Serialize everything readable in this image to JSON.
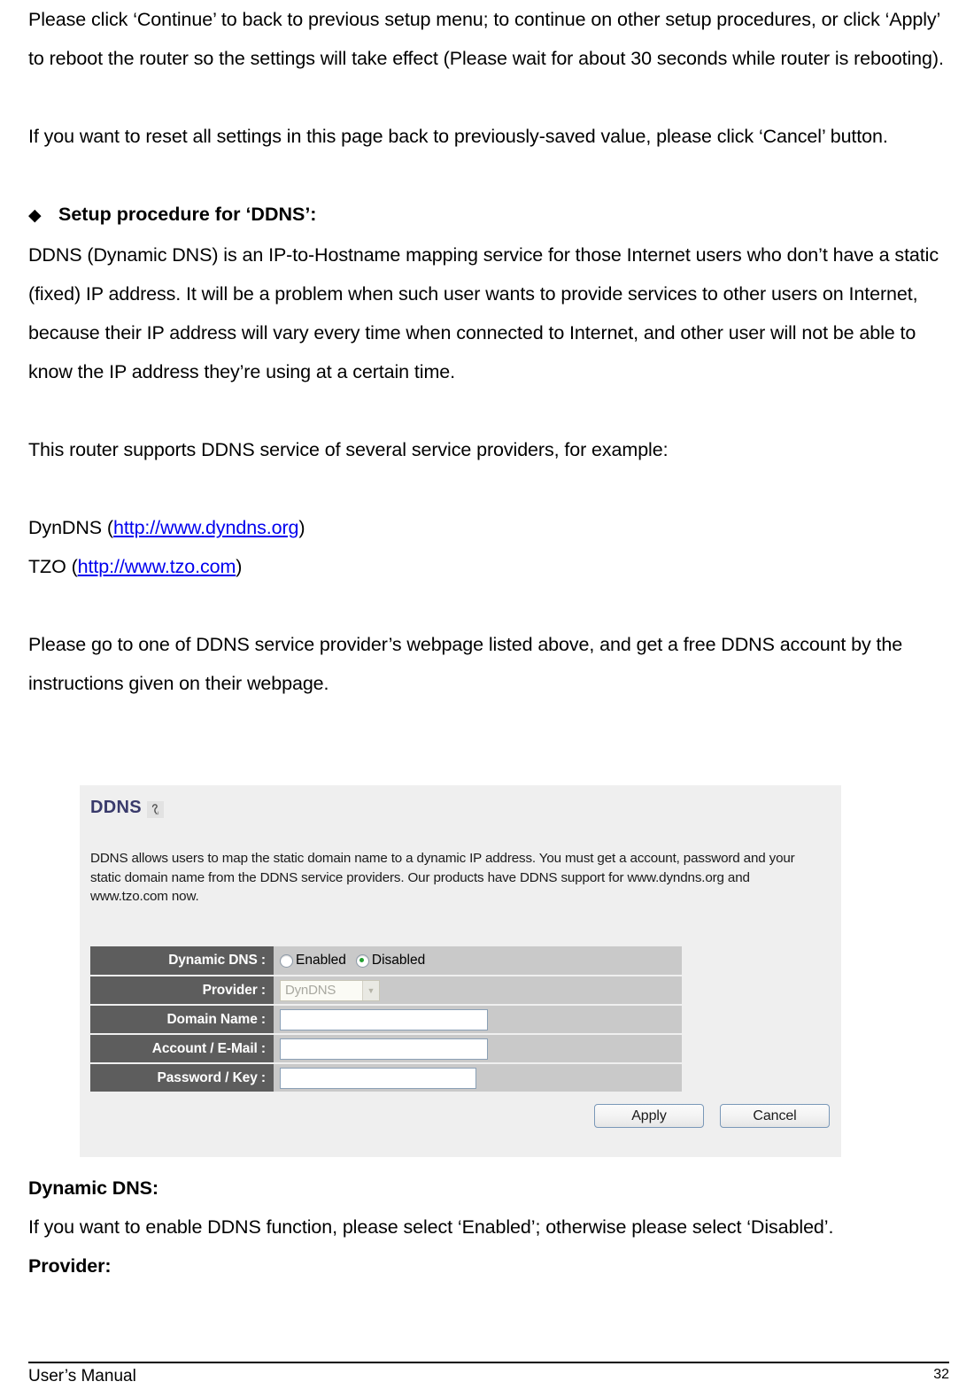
{
  "document": {
    "paragraphs": [
      "Please click ‘Continue’ to back to previous setup menu; to continue on other setup procedures, or click ‘Apply’ to reboot the router so the settings will take effect (Please wait for about 30 seconds while router is rebooting).",
      "If you want to reset all settings in this page back to previously-saved value, please click ‘Cancel’ button."
    ],
    "section_heading": {
      "bullet": "◆",
      "text": "Setup procedure for ‘DDNS’:"
    },
    "ddns_intro": "DDNS (Dynamic DNS) is an IP-to-Hostname mapping service for those Internet users who don’t have a static (fixed) IP address. It will be a problem when such user wants to provide services to other users on Internet, because their IP address will vary every time when connected to Internet, and other user will not be able to know the IP address they’re using at a certain time.",
    "providers_intro": "This router supports DDNS service of several service providers, for example:",
    "provider_links": [
      {
        "name": "DynDNS",
        "open": " (",
        "url": "http://www.dyndns.org",
        "close": ")"
      },
      {
        "name": "TZO",
        "open": " (",
        "url": "http://www.tzo.com",
        "close": ")"
      }
    ],
    "signup_text": "Please go to one of DDNS service provider’s webpage listed above, and get a free DDNS account by the instructions given on their webpage.",
    "after_panel": {
      "dynamic_dns_heading": "Dynamic DNS:",
      "dynamic_dns_body": "If you want to enable DDNS function, please select ‘Enabled’; otherwise please select ‘Disabled’.",
      "provider_heading": "Provider:"
    }
  },
  "panel": {
    "title": "DDNS",
    "title_icon": "help-question-icon",
    "description": "DDNS allows users to map the static domain name to a dynamic IP address. You must get a account, password and your static domain name from the DDNS service providers. Our products have DDNS support for www.dyndns.org and www.tzo.com now.",
    "title_color": "#393a6b",
    "label_bg": "#5d5d5d",
    "value_bg": "#c9c9c9",
    "panel_bg": "#efefef",
    "radio_accent": "#23a031",
    "rows": [
      {
        "label": "Dynamic DNS :",
        "type": "radio",
        "options": [
          {
            "label": "Enabled",
            "selected": false
          },
          {
            "label": "Disabled",
            "selected": true
          }
        ]
      },
      {
        "label": "Provider :",
        "type": "select",
        "value": "DynDNS",
        "disabled": true,
        "arrow": "▼"
      },
      {
        "label": "Domain Name :",
        "type": "text",
        "value": "",
        "width": "long"
      },
      {
        "label": "Account / E-Mail :",
        "type": "text",
        "value": "",
        "width": "long"
      },
      {
        "label": "Password / Key :",
        "type": "text",
        "value": "",
        "width": "short"
      }
    ],
    "buttons": {
      "apply": "Apply",
      "cancel": "Cancel"
    }
  },
  "footer": {
    "left": "User’s Manual",
    "page_number": "32"
  }
}
